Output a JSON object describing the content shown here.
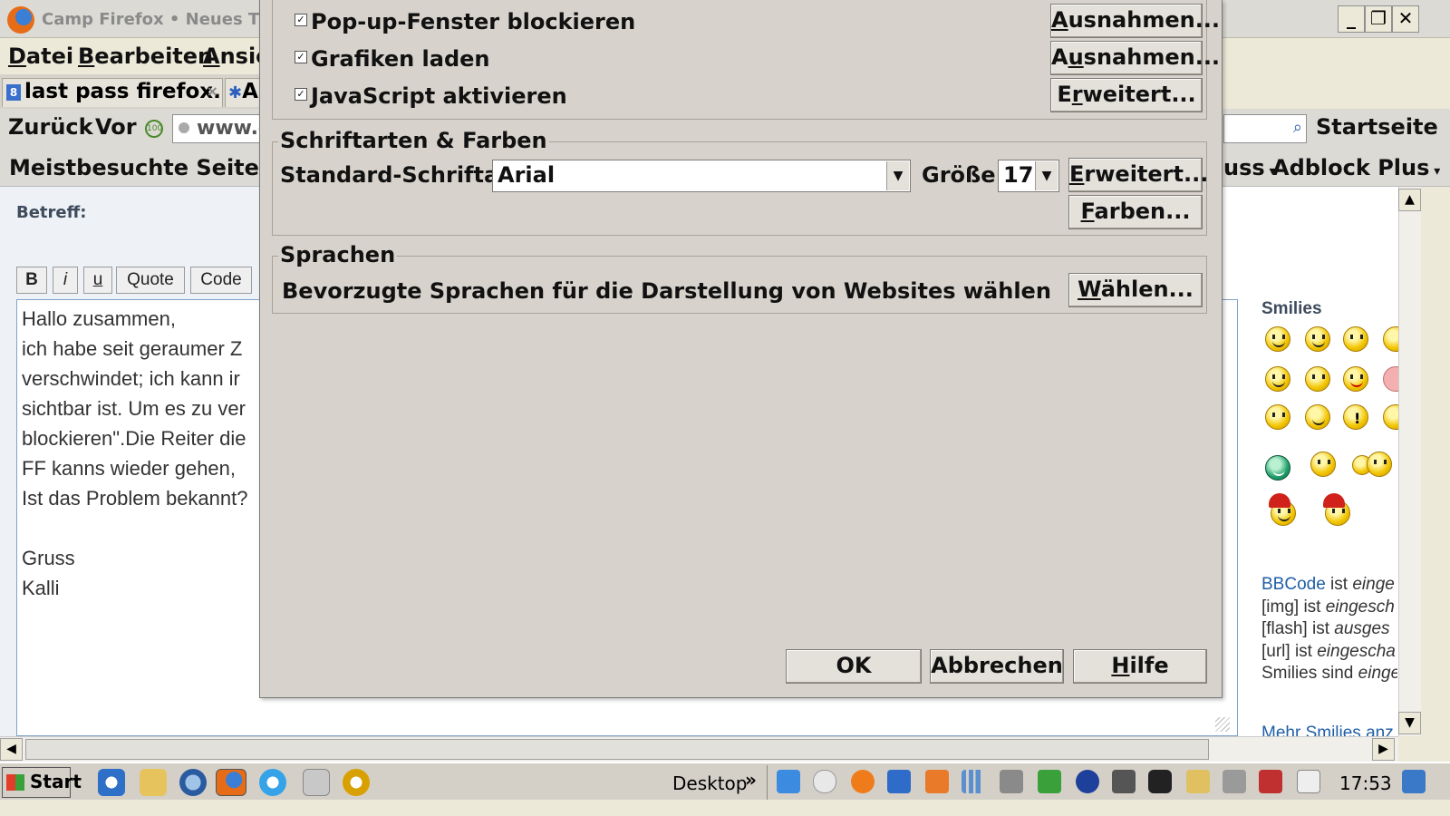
{
  "window": {
    "title": "Camp Firefox • Neues The",
    "controls": [
      "_",
      "❐",
      "✕"
    ]
  },
  "menubar": {
    "items": [
      "Datei",
      "Bearbeiten",
      "Ansic"
    ]
  },
  "tabs": [
    {
      "label": "last pass firefox...",
      "close": "×"
    },
    {
      "label": "A"
    }
  ],
  "navbar": {
    "back": "Zurück",
    "forward": "Vor",
    "url": "www.c",
    "home": "Startseite"
  },
  "bookmarks": {
    "most_visited": "Meistbesuchte Seiten",
    "partial": "uss",
    "adblock": "Adblock Plus"
  },
  "editor": {
    "subject_label": "Betreff:",
    "format_buttons": [
      "B",
      "i",
      "u",
      "Quote",
      "Code"
    ],
    "message_lines": [
      "Hallo zusammen,",
      "ich habe seit geraumer Z",
      "verschwindet; ich kann ir",
      "sichtbar ist. Um es zu ver",
      "blockieren\".Die Reiter die",
      "FF kanns wieder gehen,",
      "Ist das Problem bekannt?",
      "",
      "Gruss",
      "Kalli"
    ]
  },
  "smilies": {
    "title": "Smilies",
    "more": "Mehr Smilies anz",
    "bbcode": [
      {
        "link": "BBCode",
        "text": " ist ",
        "em": "einge"
      },
      {
        "link": "",
        "text": "[img] ist ",
        "em": "eingesch"
      },
      {
        "link": "",
        "text": "[flash] ist ",
        "em": "ausges"
      },
      {
        "link": "",
        "text": "[url] ist ",
        "em": "eingescha"
      },
      {
        "link": "",
        "text": "Smilies sind ",
        "em": "einge"
      }
    ]
  },
  "dialog": {
    "checkboxes": [
      {
        "label": "Pop-up-Fenster blockieren",
        "checked": true,
        "button": "Ausnahmen..."
      },
      {
        "label": "Grafiken laden",
        "checked": true,
        "button": "Ausnahmen..."
      },
      {
        "label": "JavaScript aktivieren",
        "checked": true,
        "button": "Erweitert..."
      }
    ],
    "fonts": {
      "group_title": "Schriftarten & Farben",
      "default_font_label": "Standard-Schriftart:",
      "default_font_value": "Arial",
      "size_label": "Größe:",
      "size_value": "17",
      "advanced_button": "Erweitert...",
      "colors_button": "Farben..."
    },
    "languages": {
      "group_title": "Sprachen",
      "description": "Bevorzugte Sprachen für die Darstellung von Websites wählen",
      "choose_button": "Wählen..."
    },
    "buttons": {
      "ok": "OK",
      "cancel": "Abbrechen",
      "help": "Hilfe"
    }
  },
  "taskbar": {
    "start": "Start",
    "desktop": "Desktop",
    "chevron": "»",
    "clock": "17:53"
  }
}
